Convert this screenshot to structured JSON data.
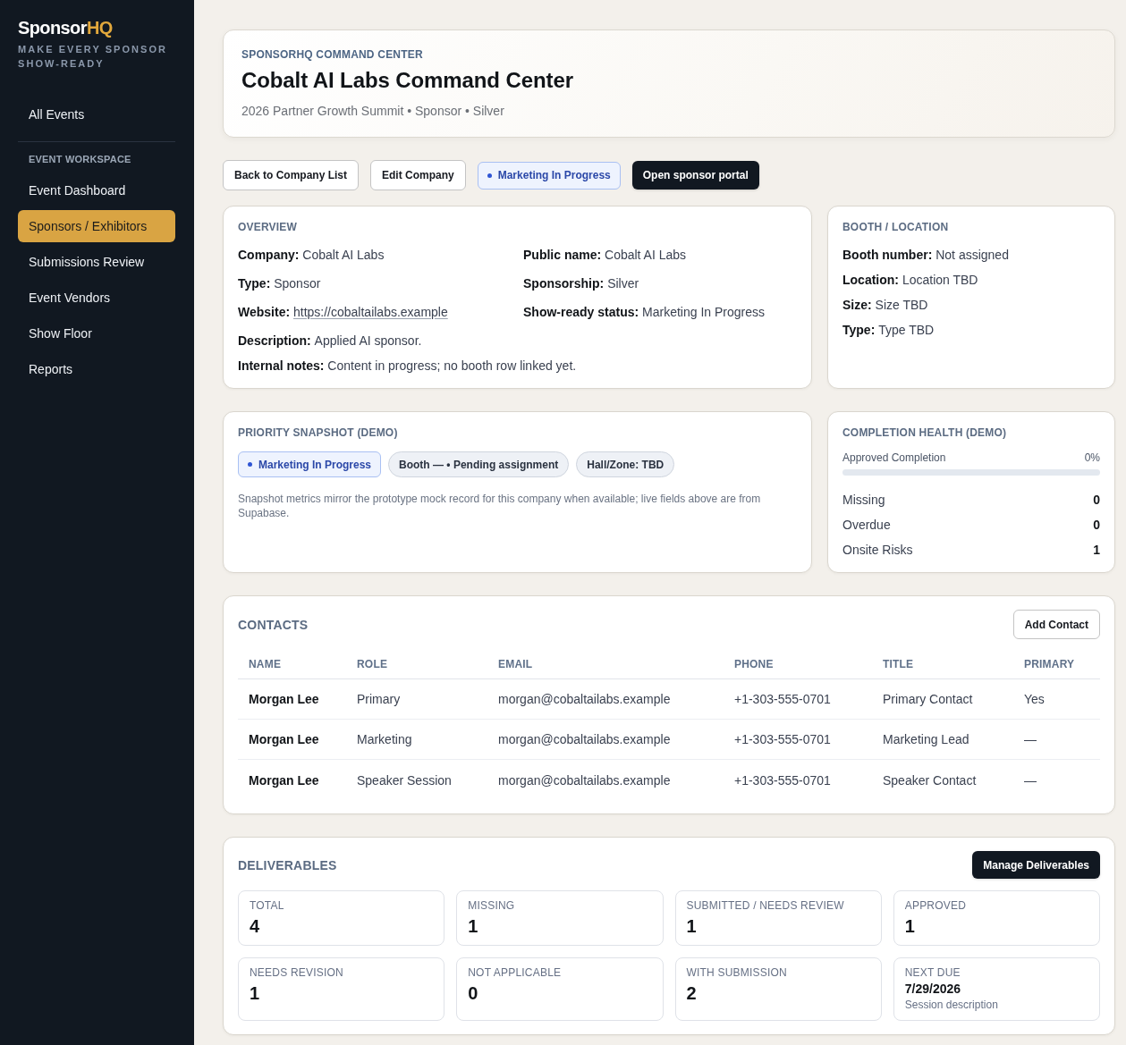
{
  "sidebar": {
    "logo": {
      "main": "Sponsor",
      "accent": "HQ"
    },
    "tagline": "MAKE EVERY SPONSOR SHOW-READY",
    "top_items": [
      {
        "label": "All Events",
        "selected": false
      }
    ],
    "section": {
      "heading": "EVENT WORKSPACE",
      "items": [
        {
          "label": "Event Dashboard",
          "selected": false
        },
        {
          "label": "Sponsors / Exhibitors",
          "selected": true
        },
        {
          "label": "Submissions Review",
          "selected": false
        },
        {
          "label": "Event Vendors",
          "selected": false
        },
        {
          "label": "Show Floor",
          "selected": false
        },
        {
          "label": "Reports",
          "selected": false
        }
      ]
    }
  },
  "header": {
    "eyebrow": "SPONSORHQ COMMAND CENTER",
    "title": "Cobalt AI Labs Command Center",
    "subtitle": "2026 Partner Growth Summit • Sponsor • Silver"
  },
  "actions": [
    {
      "label": "Back to Company List",
      "kind": "outline"
    },
    {
      "label": "Edit Company",
      "kind": "outline"
    },
    {
      "label": "Marketing In Progress",
      "kind": "status"
    },
    {
      "label": "Open sponsor portal",
      "kind": "primary"
    }
  ],
  "overview": {
    "title": "OVERVIEW",
    "fields": [
      {
        "label": "Company:",
        "value": "Cobalt AI Labs",
        "kind": "text"
      },
      {
        "label": "Public name:",
        "value": "Cobalt AI Labs",
        "kind": "text"
      },
      {
        "label": "Type:",
        "value": "Sponsor",
        "kind": "text"
      },
      {
        "label": "Sponsorship:",
        "value": "Silver",
        "kind": "text"
      },
      {
        "label": "Website:",
        "value": "https://cobaltailabs.example",
        "kind": "link"
      },
      {
        "label": "Show-ready status:",
        "value": "Marketing In Progress",
        "kind": "text"
      }
    ],
    "notes": [
      {
        "label": "Description:",
        "value": "Applied AI sponsor.",
        "kind": "text"
      },
      {
        "label": "Internal notes:",
        "value": "Content in progress; no booth row linked yet.",
        "kind": "text"
      }
    ]
  },
  "booth": {
    "title": "BOOTH / LOCATION",
    "fields": [
      {
        "label": "Booth number:",
        "value": "Not assigned",
        "kind": "text"
      },
      {
        "label": "Location:",
        "value": "Location TBD",
        "kind": "text"
      },
      {
        "label": "Size:",
        "value": "Size TBD",
        "kind": "text"
      },
      {
        "label": "Type:",
        "value": "Type TBD",
        "kind": "text"
      }
    ]
  },
  "snapshot": {
    "title": "PRIORITY SNAPSHOT (DEMO)",
    "chips": [
      {
        "label": "Marketing In Progress",
        "kind": "status"
      },
      {
        "label": "Booth — • Pending assignment",
        "kind": "tag"
      },
      {
        "label": "Hall/Zone: TBD",
        "kind": "tag"
      }
    ],
    "note": "Snapshot metrics mirror the prototype mock record for this company when available; live fields above are from Supabase."
  },
  "health": {
    "title": "COMPLETION HEALTH (DEMO)",
    "progress": {
      "label": "Approved Completion",
      "reading": "0%",
      "level": 0
    },
    "metrics": [
      {
        "label": "Missing",
        "value": "0"
      },
      {
        "label": "Overdue",
        "value": "0"
      },
      {
        "label": "Onsite Risks",
        "value": "1"
      }
    ]
  },
  "contacts": {
    "title": "CONTACTS",
    "button": "Add Contact",
    "columns": [
      "NAME",
      "ROLE",
      "EMAIL",
      "PHONE",
      "TITLE",
      "PRIMARY"
    ],
    "rows": [
      [
        "Morgan Lee",
        "Primary",
        "morgan@cobaltailabs.example",
        "+1-303-555-0701",
        "Primary Contact",
        "Yes"
      ],
      [
        "Morgan Lee",
        "Marketing",
        "morgan@cobaltailabs.example",
        "+1-303-555-0701",
        "Marketing Lead",
        "—"
      ],
      [
        "Morgan Lee",
        "Speaker Session",
        "morgan@cobaltailabs.example",
        "+1-303-555-0701",
        "Speaker Contact",
        "—"
      ]
    ]
  },
  "deliverables": {
    "title": "DELIVERABLES",
    "button": "Manage Deliverables",
    "stats": [
      {
        "label": "TOTAL",
        "value": "4",
        "kind": "count"
      },
      {
        "label": "MISSING",
        "value": "1",
        "kind": "count"
      },
      {
        "label": "SUBMITTED / NEEDS REVIEW",
        "value": "1",
        "kind": "count"
      },
      {
        "label": "APPROVED",
        "value": "1",
        "kind": "count"
      },
      {
        "label": "NEEDS REVISION",
        "value": "1",
        "kind": "count"
      },
      {
        "label": "NOT APPLICABLE",
        "value": "0",
        "kind": "count"
      },
      {
        "label": "WITH SUBMISSION",
        "value": "2",
        "kind": "count"
      },
      {
        "label": "NEXT DUE",
        "value": "7/29/2026",
        "note": "Session description",
        "kind": "date"
      }
    ]
  }
}
